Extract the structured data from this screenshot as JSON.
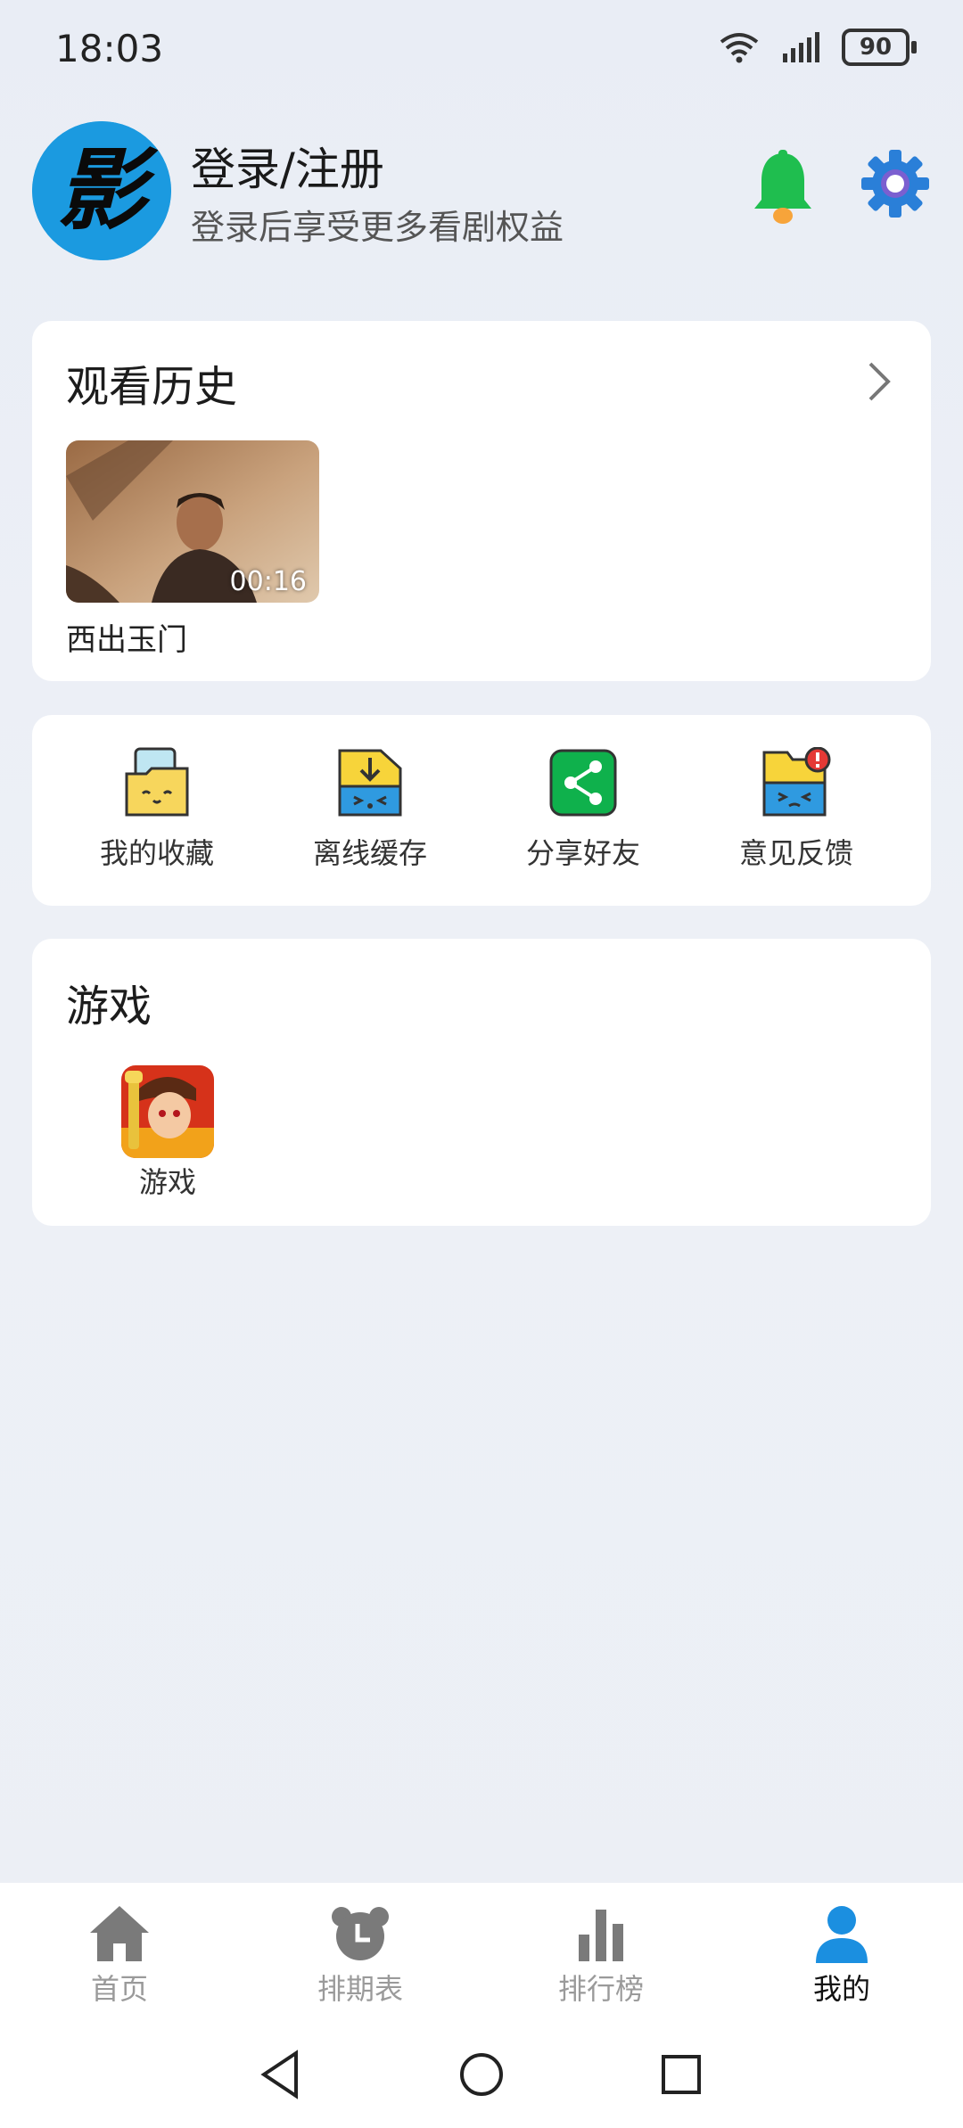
{
  "status_bar": {
    "time": "18:03",
    "battery": "90",
    "icons": [
      "wifi-icon",
      "signal-icon",
      "battery-icon"
    ]
  },
  "profile": {
    "title": "登录/注册",
    "subtitle": "登录后享受更多看剧权益",
    "avatar_glyph": "影"
  },
  "history": {
    "title": "观看历史",
    "items": [
      {
        "title": "西出玉门",
        "duration": "00:16"
      }
    ]
  },
  "tools": [
    {
      "label": "我的收藏",
      "icon": "favorites-folder-icon"
    },
    {
      "label": "离线缓存",
      "icon": "download-folder-icon"
    },
    {
      "label": "分享好友",
      "icon": "share-icon"
    },
    {
      "label": "意见反馈",
      "icon": "feedback-folder-icon"
    }
  ],
  "games": {
    "title": "游戏",
    "items": [
      {
        "label": "游戏"
      }
    ]
  },
  "tabs": [
    {
      "label": "首页",
      "icon": "home-icon",
      "active": false
    },
    {
      "label": "排期表",
      "icon": "alarm-clock-icon",
      "active": false
    },
    {
      "label": "排行榜",
      "icon": "bar-chart-icon",
      "active": false
    },
    {
      "label": "我的",
      "icon": "user-icon",
      "active": true
    }
  ],
  "colors": {
    "accent": "#1b8fe0",
    "bell": "#1fbe4f",
    "gear": "#2a7fd8",
    "share": "#0fb14c"
  }
}
